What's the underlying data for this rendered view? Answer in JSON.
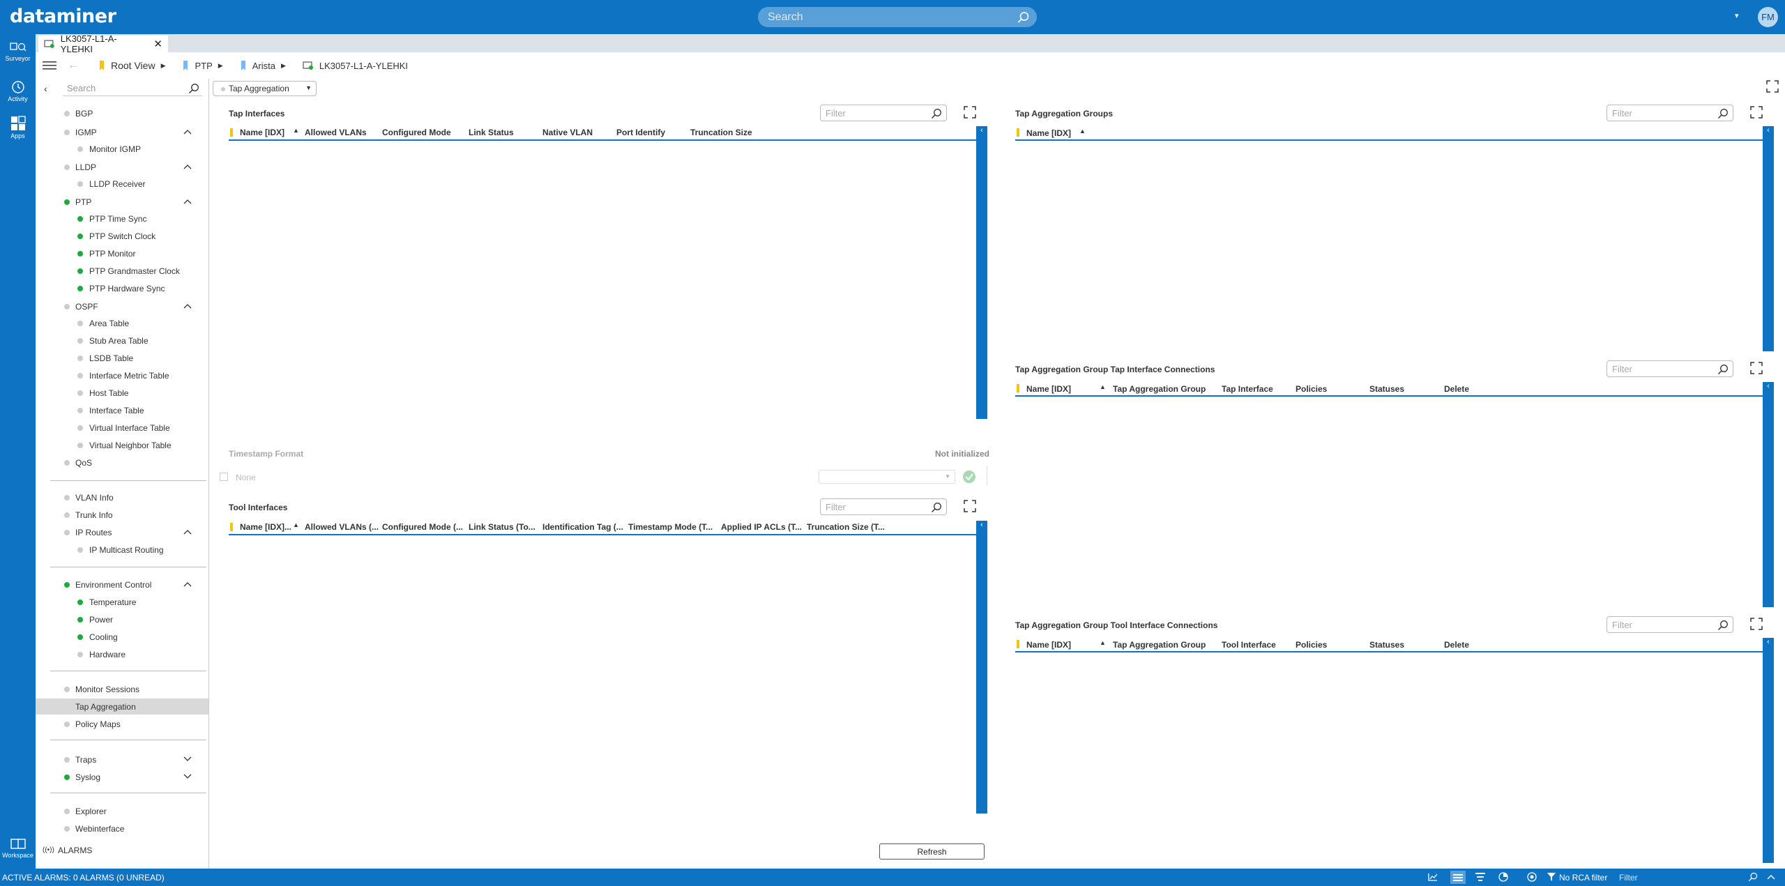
{
  "header": {
    "logo": "dataminer",
    "search_placeholder": "Search",
    "menu_chevron": "▾",
    "avatar": "FM",
    "accent": "#0f73c3"
  },
  "leftbar": {
    "items": [
      {
        "label": "Surveyor"
      },
      {
        "label": "Activity"
      },
      {
        "label": "Apps"
      },
      {
        "label": "Workspace"
      }
    ]
  },
  "tab": {
    "title": "LK3057-L1-A-YLEHKI",
    "close": "✕"
  },
  "breadcrumb": {
    "root": "Root View",
    "ptp": "PTP",
    "arista": "Arista",
    "element": "LK3057-L1-A-YLEHKI"
  },
  "sidebar": {
    "search_placeholder": "Search",
    "groups": {
      "bgp": "BGP",
      "igmp": "IGMP",
      "monitor_igmp": "Monitor IGMP",
      "lldp": "LLDP",
      "lldp_receiver": "LLDP Receiver",
      "ptp": "PTP",
      "ptp_time_sync": "PTP Time Sync",
      "ptp_switch_clock": "PTP Switch Clock",
      "ptp_monitor": "PTP Monitor",
      "ptp_grandmaster": "PTP Grandmaster Clock",
      "ptp_hw_sync": "PTP Hardware Sync",
      "ospf": "OSPF",
      "area_table": "Area Table",
      "stub_area_table": "Stub Area Table",
      "lsdb_table": "LSDB Table",
      "interface_metric_table": "Interface Metric Table",
      "host_table": "Host Table",
      "interface_table": "Interface Table",
      "virtual_interface_table": "Virtual Interface Table",
      "virtual_neighbor_table": "Virtual Neighbor Table",
      "qos": "QoS",
      "vlan_info": "VLAN Info",
      "trunk_info": "Trunk Info",
      "ip_routes": "IP Routes",
      "ip_multicast_routing": "IP Multicast Routing",
      "environment_control": "Environment Control",
      "temperature": "Temperature",
      "power": "Power",
      "cooling": "Cooling",
      "hardware": "Hardware",
      "monitor_sessions": "Monitor Sessions",
      "tap_aggregation": "Tap Aggregation",
      "policy_maps": "Policy Maps",
      "traps": "Traps",
      "syslog": "Syslog",
      "explorer": "Explorer",
      "webinterface": "Webinterface"
    },
    "alarms": "ALARMS"
  },
  "toolbar": {
    "dropdown": "Tap Aggregation"
  },
  "tap_interfaces": {
    "title": "Tap Interfaces",
    "filter": "Filter",
    "columns": [
      "Name [IDX]",
      "Allowed VLANs",
      "Configured Mode",
      "Link Status",
      "Native VLAN",
      "Port Identify",
      "Truncation Size"
    ]
  },
  "timestamp": {
    "label": "Timestamp Format",
    "status": "Not initialized",
    "checkbox_label": "None"
  },
  "tool_interfaces": {
    "title": "Tool Interfaces",
    "filter": "Filter",
    "columns": [
      "Name [IDX]...",
      "Allowed VLANs (...",
      "Configured Mode (...",
      "Link Status (To...",
      "Identification Tag (...",
      "Timestamp Mode (T...",
      "Applied IP ACLs (T...",
      "Truncation Size (T..."
    ]
  },
  "tap_groups": {
    "title": "Tap Aggregation Groups",
    "filter": "Filter",
    "columns": [
      "Name [IDX]"
    ]
  },
  "tap_group_tap_conn": {
    "title": "Tap Aggregation Group Tap Interface Connections",
    "filter": "Filter",
    "columns": [
      "Name [IDX]",
      "Tap Aggregation Group",
      "Tap Interface",
      "Policies",
      "Statuses",
      "Delete"
    ]
  },
  "tap_group_tool_conn": {
    "title": "Tap Aggregation Group Tool Interface Connections",
    "filter": "Filter",
    "columns": [
      "Name [IDX]",
      "Tap Aggregation Group",
      "Tool Interface",
      "Policies",
      "Statuses",
      "Delete"
    ]
  },
  "refresh_label": "Refresh",
  "status": {
    "text": "ACTIVE ALARMS: 0 ALARMS (0 UNREAD)",
    "rca": "No RCA filter",
    "filter": "Filter"
  }
}
